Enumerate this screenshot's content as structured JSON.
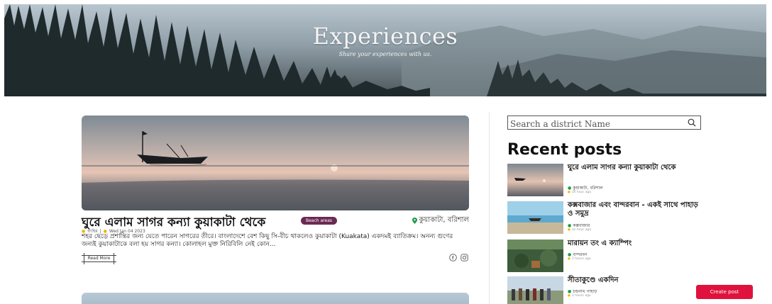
{
  "hero": {
    "title": "Experiences",
    "subtitle": "Share your experiences with us."
  },
  "featured_post": {
    "title": "ঘুরে এলাম সাগর কন্যা কুয়াকাটা থেকে",
    "tag": "Beach areas",
    "location": "কুয়াকাটা, বরিশাল",
    "author": "ফাহিম",
    "separator": "|",
    "date": "Wed Jan 04 2023",
    "excerpt": "শহর ছেড়ে প্রশান্তির জন্য যেতে পারেন সাগরের তীরে। বাংলাদেশে বেশ কিছু সি-বীচ থাকলেও কুয়াকাটা (Kuakata) একদমই ব্যাতিক্রম। অনন্য গুণের জন্যই কুয়াকাটাকে বলা হয় সাগর কন্যা। কোলাহল মুক্ত নিরিবিলি নেই কোন...",
    "read_more": "Read More",
    "icons": [
      "pin-icon",
      "facebook-icon",
      "instagram-icon"
    ]
  },
  "sidebar": {
    "search_placeholder": "Search a district Name",
    "recent_title": "Recent posts",
    "recent_posts": [
      {
        "title": "ঘুরে এলাম সাগর কন্যা কুয়াকাটা থেকে",
        "location": "কুয়াকাটা, বরিশাল",
        "time": "an hour ago"
      },
      {
        "title": "কক্সবাজার এবং বান্দরবান - একই সাথে পাহাড় ও সমুদ্র",
        "location": "কক্সবাজার",
        "time": "an hour ago"
      },
      {
        "title": "মারায়ন তং এ ক্যাম্পিং",
        "location": "বান্দরবন",
        "time": "2 hours ago"
      },
      {
        "title": "সীতাকুণ্ডে একদিন",
        "location": "চন্দ্রনাথ পাহাড়",
        "time": "2 hours ago"
      }
    ]
  },
  "actions": {
    "create_post": "Create post"
  },
  "colors": {
    "tag_bg": "#6b2a52",
    "create_btn": "#e0123d",
    "time_dot": "#f2b600"
  }
}
